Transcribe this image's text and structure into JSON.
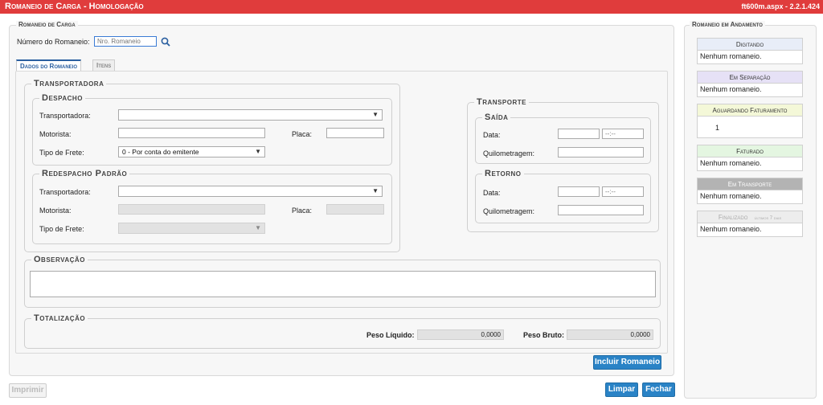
{
  "app": {
    "title": "Romaneio de Carga  - Homologação",
    "version": "ft600m.aspx - 2.2.1.424"
  },
  "main": {
    "legend": "Romaneio de Carga",
    "numero_label": "Número do Romaneio:",
    "numero_placeholder": "Nro. Romaneio",
    "tabs": [
      {
        "label": "Dados do Romaneio"
      },
      {
        "label": "Itens"
      }
    ]
  },
  "transportadora": {
    "legend": "Transportadora",
    "despacho": {
      "legend": "Despacho",
      "transportadora_label": "Transportadora:",
      "motorista_label": "Motorista:",
      "placa_label": "Placa:",
      "tipo_frete_label": "Tipo de Frete:",
      "tipo_frete_value": "0 - Por conta do emitente"
    },
    "redespacho": {
      "legend": "Redespacho Padrão",
      "transportadora_label": "Transportadora:",
      "motorista_label": "Motorista:",
      "placa_label": "Placa:",
      "tipo_frete_label": "Tipo de Frete:"
    }
  },
  "transporte": {
    "legend": "Transporte",
    "saida": {
      "legend": "Saída",
      "data_label": "Data:",
      "hora_placeholder": "--:--",
      "quilometragem_label": "Quilometragem:"
    },
    "retorno": {
      "legend": "Retorno",
      "data_label": "Data:",
      "hora_placeholder": "--:--",
      "quilometragem_label": "Quilometragem:"
    }
  },
  "observacao": {
    "legend": "Observação"
  },
  "totalizacao": {
    "legend": "Totalização",
    "peso_liquido_label": "Peso Líquido:",
    "peso_liquido_value": "0,0000",
    "peso_bruto_label": "Peso Bruto:",
    "peso_bruto_value": "0,0000"
  },
  "buttons": {
    "incluir": "Incluir Romaneio",
    "imprimir": "Imprimir",
    "limpar": "Limpar",
    "fechar": "Fechar"
  },
  "sidebar": {
    "legend": "Romaneio em Andamento",
    "cards": [
      {
        "title": "Digitando",
        "content": "Nenhum romaneio.",
        "color": "#e8edf8"
      },
      {
        "title": "Em Separação",
        "content": "Nenhum romaneio.",
        "color": "#e6e1f6"
      },
      {
        "title": "Aguardando Faturamento",
        "content": "1",
        "color": "#f4f8d8"
      },
      {
        "title": "Faturado",
        "content": "Nenhum romaneio.",
        "color": "#e4f6e1"
      },
      {
        "title": "Em Transporte",
        "content": "Nenhum romaneio.",
        "color": "#b3b3b3"
      },
      {
        "title": "Finalizado",
        "subtitle": "últimos 7 dias",
        "content": "Nenhum romaneio.",
        "color": "#ededed"
      }
    ]
  }
}
